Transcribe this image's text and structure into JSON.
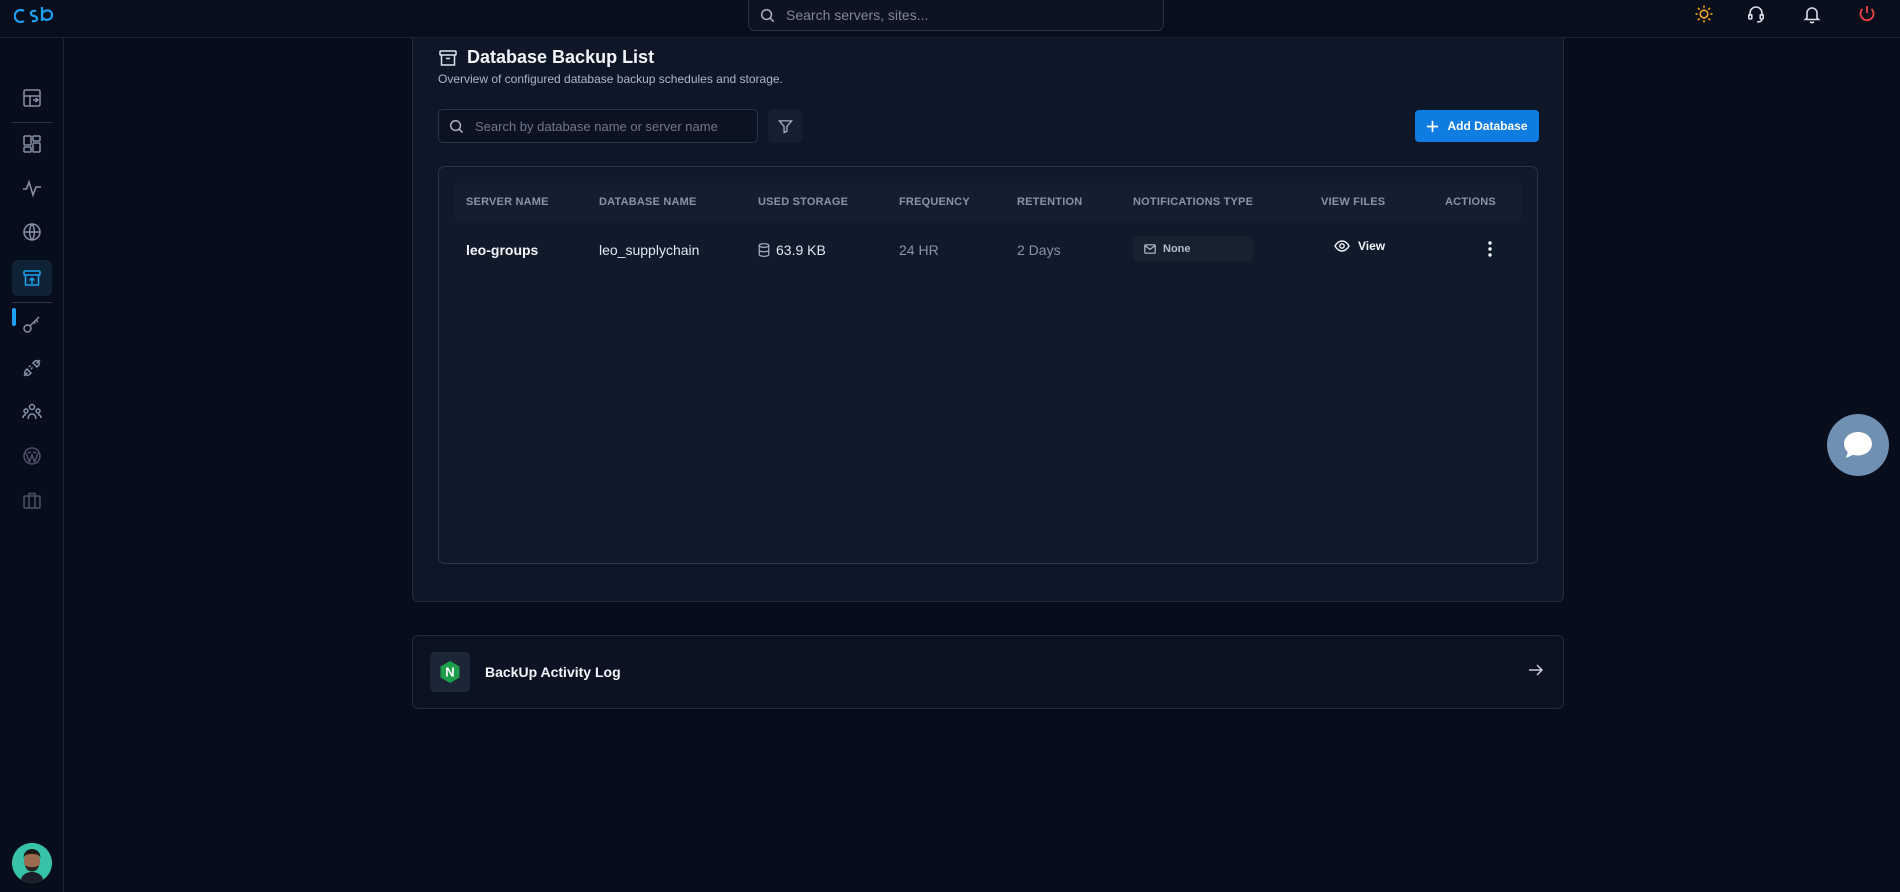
{
  "topbar": {
    "search_placeholder": "Search servers, sites...",
    "icons": [
      "sun-icon",
      "support-headset-icon",
      "bell-icon",
      "power-icon"
    ],
    "colors": {
      "sun": "#f5a524",
      "power": "#ef4444"
    }
  },
  "sidebar": {
    "items": [
      "dashboard-switch-icon",
      "apps-grid-icon",
      "activity-pulse-icon",
      "globe-icon",
      "backup-archive-icon",
      "key-icon",
      "plug-icon",
      "team-users-icon",
      "wordpress-icon",
      "briefcase-icon"
    ],
    "active_item": "backup-archive-icon",
    "accent": "#1ea1f2"
  },
  "backup_list": {
    "title": "Database Backup List",
    "subtitle": "Overview of configured database backup schedules and storage.",
    "search_placeholder": "Search by database name or server name",
    "add_button_label": "Add Database",
    "columns": [
      "SERVER NAME",
      "DATABASE NAME",
      "USED STORAGE",
      "FREQUENCY",
      "RETENTION",
      "NOTIFICATIONS TYPE",
      "VIEW FILES",
      "ACTIONS"
    ],
    "rows": [
      {
        "server_name": "leo-groups",
        "database_name": "leo_supplychain",
        "used_storage": "63.9 KB",
        "frequency": "24 HR",
        "retention": "2 Days",
        "notifications_type": "None",
        "view_label": "View"
      }
    ]
  },
  "activity_log": {
    "title": "BackUp Activity Log",
    "badge_letter": "N",
    "badge_color": "#1e9e4a"
  }
}
